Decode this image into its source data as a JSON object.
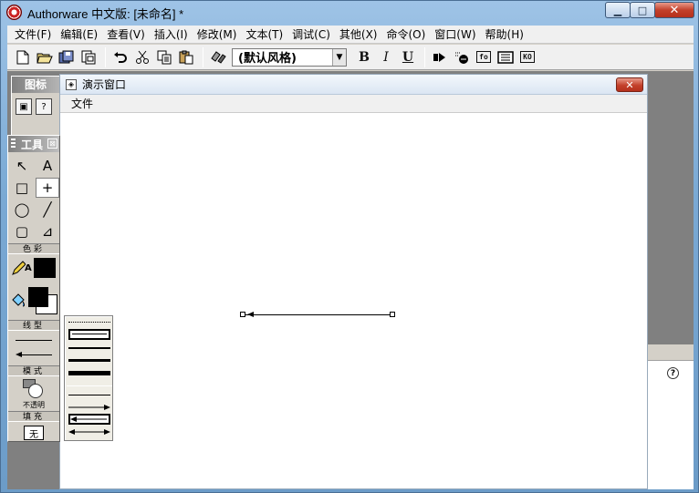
{
  "window": {
    "title": "Authorware 中文版: [未命名] *",
    "minimize_label": "▁",
    "maximize_label": "□",
    "close_label": "✕"
  },
  "menubar": [
    "文件(F)",
    "编辑(E)",
    "查看(V)",
    "插入(I)",
    "修改(M)",
    "文本(T)",
    "调试(C)",
    "其他(X)",
    "命令(O)",
    "窗口(W)",
    "帮助(H)"
  ],
  "toolbar": {
    "style_value": "(默认风格)",
    "bold_label": "B",
    "italic_label": "I",
    "underline_label": "U",
    "fn_label": "fo",
    "ko_label": "KO"
  },
  "icon_palette": {
    "title": "图标"
  },
  "presentation": {
    "title": "演示窗口",
    "menu_file": "文件",
    "close_label": "✕"
  },
  "tools": {
    "title": "工具",
    "close_label": "⊠",
    "select_glyph": "↖",
    "text_glyph": "A",
    "rect_glyph": "□",
    "cross_glyph": "+",
    "ellipse_glyph": "◯",
    "diag_glyph": "╱",
    "roundrect_glyph": "▢",
    "polygon_glyph": "⊿",
    "color_section": "色彩",
    "line_section": "线型",
    "mode_section": "模式",
    "mode_value": "不透明",
    "fill_section": "填充",
    "fill_value": "无",
    "pencil_label": "A"
  },
  "colors": {
    "accent_close": "#c3402b",
    "titlebar": "#9ec3e6",
    "workspace": "#808080",
    "palette_bg": "#d4d0c8"
  }
}
